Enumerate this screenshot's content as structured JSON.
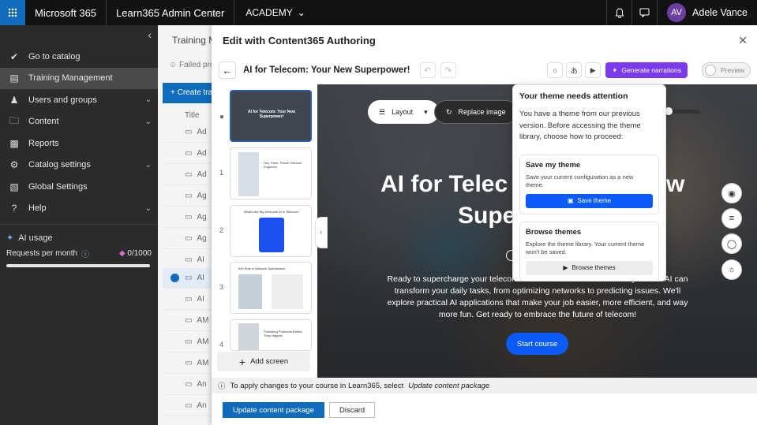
{
  "topbar": {
    "app_name": "Microsoft 365",
    "product": "Learn365 Admin Center",
    "academy": "ACADEMY",
    "user_initials": "AV",
    "user_name": "Adele Vance"
  },
  "sidebar": {
    "items": [
      {
        "label": "Go to catalog",
        "icon": "check-circle-icon"
      },
      {
        "label": "Training Management",
        "icon": "training-icon"
      },
      {
        "label": "Users and groups",
        "icon": "users-icon"
      },
      {
        "label": "Content",
        "icon": "folder-icon"
      },
      {
        "label": "Reports",
        "icon": "chart-icon"
      },
      {
        "label": "Catalog settings",
        "icon": "gear-icon"
      },
      {
        "label": "Global Settings",
        "icon": "settings-doc-icon"
      },
      {
        "label": "Help",
        "icon": "question-icon"
      }
    ],
    "ai_usage": "AI usage",
    "requests_label": "Requests per month",
    "requests_value": "0/1000"
  },
  "background": {
    "title": "Training M",
    "failed": "Failed pro",
    "create_button": "+ Create tra",
    "column": "Title",
    "rows": [
      "Ad",
      "Ad",
      "Ad",
      "Ag",
      "Ag",
      "Ag",
      "AI",
      "AI",
      "AI",
      "AM",
      "AM",
      "AM",
      "An",
      "An"
    ]
  },
  "panel": {
    "header": "Edit with Content365 Authoring",
    "course_title": "AI for Telecom: Your New Superpower!",
    "generate_label": "Generate narrations",
    "preview_label": "Preview",
    "thumbs": [
      {
        "num": "",
        "caption": "AI for Telecom: Your New Superpower!"
      },
      {
        "num": "1",
        "caption": "Hey There, Future Telecom Engineer!"
      },
      {
        "num": "2",
        "caption": "What's the Big Deal with AI in Telecom?"
      },
      {
        "num": "3",
        "caption": "AI's Role in Network Optimization"
      },
      {
        "num": "4",
        "caption": "Predicting Problems Before They Happen"
      }
    ],
    "add_screen": "Add screen",
    "layout_label": "Layout",
    "replace_image": "Replace image",
    "hero_line1": "AI for Telec",
    "hero_line1_end": "w",
    "hero_line2": "Supe",
    "description": "Ready to supercharge your telecom career? This course will show you how AI can transform your daily tasks, from optimizing networks to predicting issues. We'll explore practical AI applications that make your job easier, more efficient, and way more fun. Get ready to embrace the future of telecom!",
    "start_course": "Start course",
    "info_text": "To apply changes to your course in Learn365, select",
    "info_link": "Update content package",
    "update_button": "Update content package",
    "discard_button": "Discard"
  },
  "theme_popup": {
    "title": "Your theme needs attention",
    "text": "You have a theme from our previous version. Before accessing the theme library, choose how to proceed:",
    "save_title": "Save my theme",
    "save_desc": "Save your current configuration as a new theme.",
    "save_button": "Save theme",
    "browse_title": "Browse themes",
    "browse_desc": "Explore the theme library. Your current theme won't be saved.",
    "browse_button": "Browse themes"
  },
  "colors": {
    "accent": "#0f6cbd",
    "generate": "#7c3aed",
    "start": "#0b5cf7"
  }
}
